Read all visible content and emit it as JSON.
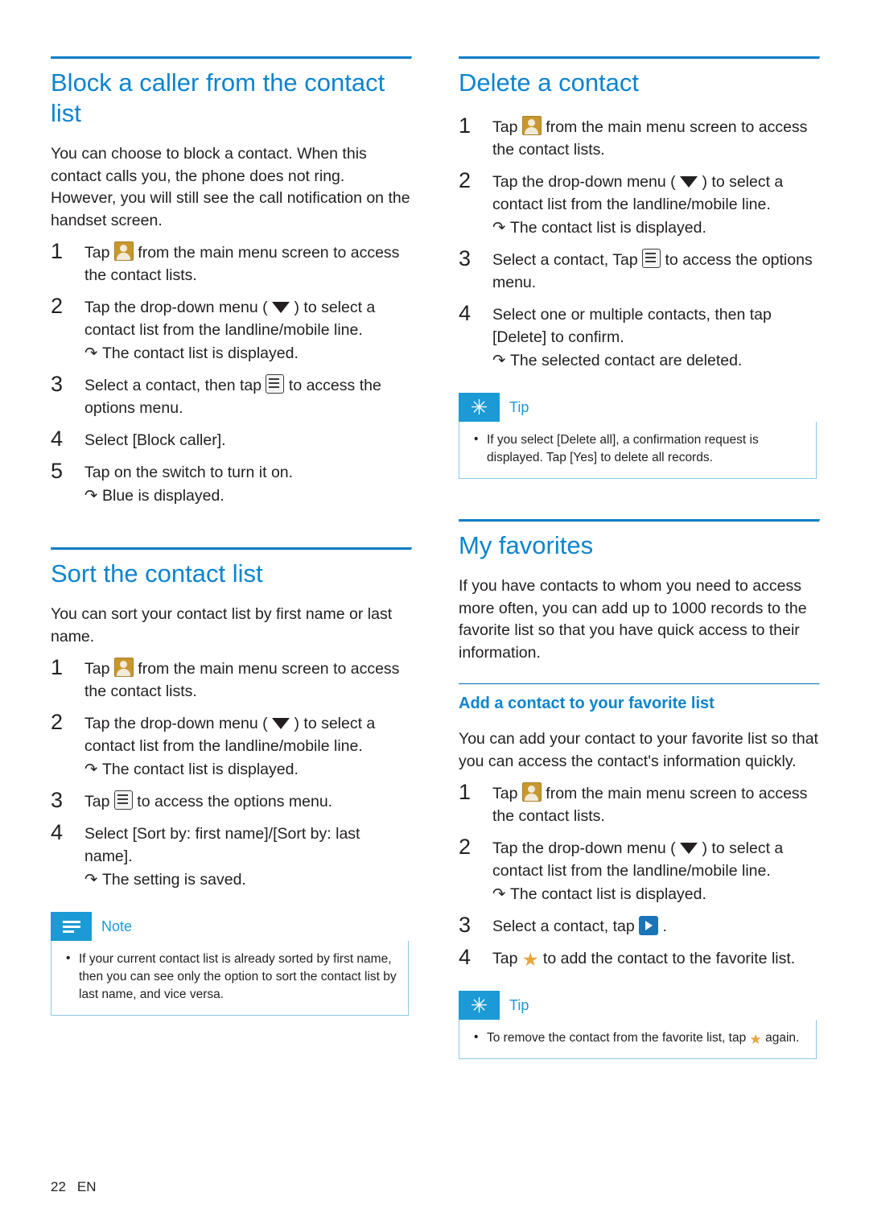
{
  "page": {
    "number": "22",
    "lang": "EN"
  },
  "left_column": {
    "section1": {
      "title": "Block a caller from the contact list",
      "intro": "You can choose to block a contact. When this contact calls you, the phone does not ring. However, you will still see the call notification on the handset screen.",
      "steps": [
        {
          "num": "1",
          "text_before": "Tap",
          "icon": "contacts-icon",
          "text_after": "from the main menu screen to access the contact lists."
        },
        {
          "num": "2",
          "text_before": "Tap the drop-down menu (",
          "icon": "caret-down-icon",
          "text_after": ") to select a contact list from the landline/mobile line.",
          "result": "The contact list is displayed."
        },
        {
          "num": "3",
          "text_before": "Select a contact, then tap",
          "icon": "options-menu-icon",
          "text_after": "to access the options menu."
        },
        {
          "num": "4",
          "text_before": "Select [Block caller].",
          "icon": "",
          "text_after": ""
        },
        {
          "num": "5",
          "text_before": "Tap on the switch to turn it on.",
          "icon": "",
          "text_after": "",
          "result": "Blue is displayed."
        }
      ]
    },
    "section2": {
      "title": "Sort the contact list",
      "intro": "You can sort your contact list by first name or last name.",
      "steps": [
        {
          "num": "1",
          "text_before": "Tap",
          "icon": "contacts-icon",
          "text_after": "from the main menu screen to access the contact lists."
        },
        {
          "num": "2",
          "text_before": "Tap the drop-down menu (",
          "icon": "caret-down-icon",
          "text_after": ") to select a contact list from the landline/mobile line.",
          "result": "The contact list is displayed."
        },
        {
          "num": "3",
          "text_before": "Tap",
          "icon": "options-menu-icon",
          "text_after": "to access the options menu."
        },
        {
          "num": "4",
          "text_before": "Select [Sort by: first name]/[Sort by: last name].",
          "icon": "",
          "text_after": "",
          "result": "The setting is saved."
        }
      ],
      "note": {
        "label": "Note",
        "badge": "note-lines-icon",
        "items": [
          "If your current contact list is already sorted by first name, then you can see only the option to sort the contact list by last name, and vice versa."
        ]
      }
    }
  },
  "right_column": {
    "section1": {
      "title": "Delete a contact",
      "steps": [
        {
          "num": "1",
          "text_before": "Tap",
          "icon": "contacts-icon",
          "text_after": "from the main menu screen to access the contact lists."
        },
        {
          "num": "2",
          "text_before": "Tap the drop-down menu (",
          "icon": "caret-down-icon",
          "text_after": ") to select a contact list from the landline/mobile line.",
          "result": "The contact list is displayed."
        },
        {
          "num": "3",
          "text_before": "Select a contact, Tap",
          "icon": "options-menu-icon",
          "text_after": "to access the options menu."
        },
        {
          "num": "4",
          "text_before": "Select one or multiple contacts, then tap [Delete] to confirm.",
          "icon": "",
          "text_after": "",
          "result": "The selected contact are deleted."
        }
      ],
      "tip": {
        "label": "Tip",
        "badge": "tip-star-icon",
        "items": [
          "If you select [Delete all], a confirmation request is displayed. Tap [Yes] to delete all records."
        ]
      }
    },
    "section2": {
      "title": "My favorites",
      "intro": "If you have contacts to whom you need to access more often, you can add up to 1000 records to the favorite list so that you have quick access to their information.",
      "subsection": {
        "title": "Add a contact to your favorite list",
        "intro": "You can add your contact to your favorite list so that you can access the contact's information quickly.",
        "steps": [
          {
            "num": "1",
            "text_before": "Tap",
            "icon": "contacts-icon",
            "text_after": "from the main menu screen to access the contact lists."
          },
          {
            "num": "2",
            "text_before": "Tap the drop-down menu (",
            "icon": "caret-down-icon",
            "text_after": ") to select a contact list from the landline/mobile line.",
            "result": "The contact list is displayed."
          },
          {
            "num": "3",
            "text_before": "Select a contact, tap",
            "icon": "play-button-icon",
            "text_after": "."
          },
          {
            "num": "4",
            "text_before": "Tap",
            "icon": "star-icon",
            "text_after": "to add the contact to the favorite list."
          }
        ],
        "tip": {
          "label": "Tip",
          "badge": "tip-star-icon",
          "items_before": "To remove the contact from the favorite list, tap",
          "items_icon": "star-icon",
          "items_after": "again."
        }
      }
    }
  }
}
